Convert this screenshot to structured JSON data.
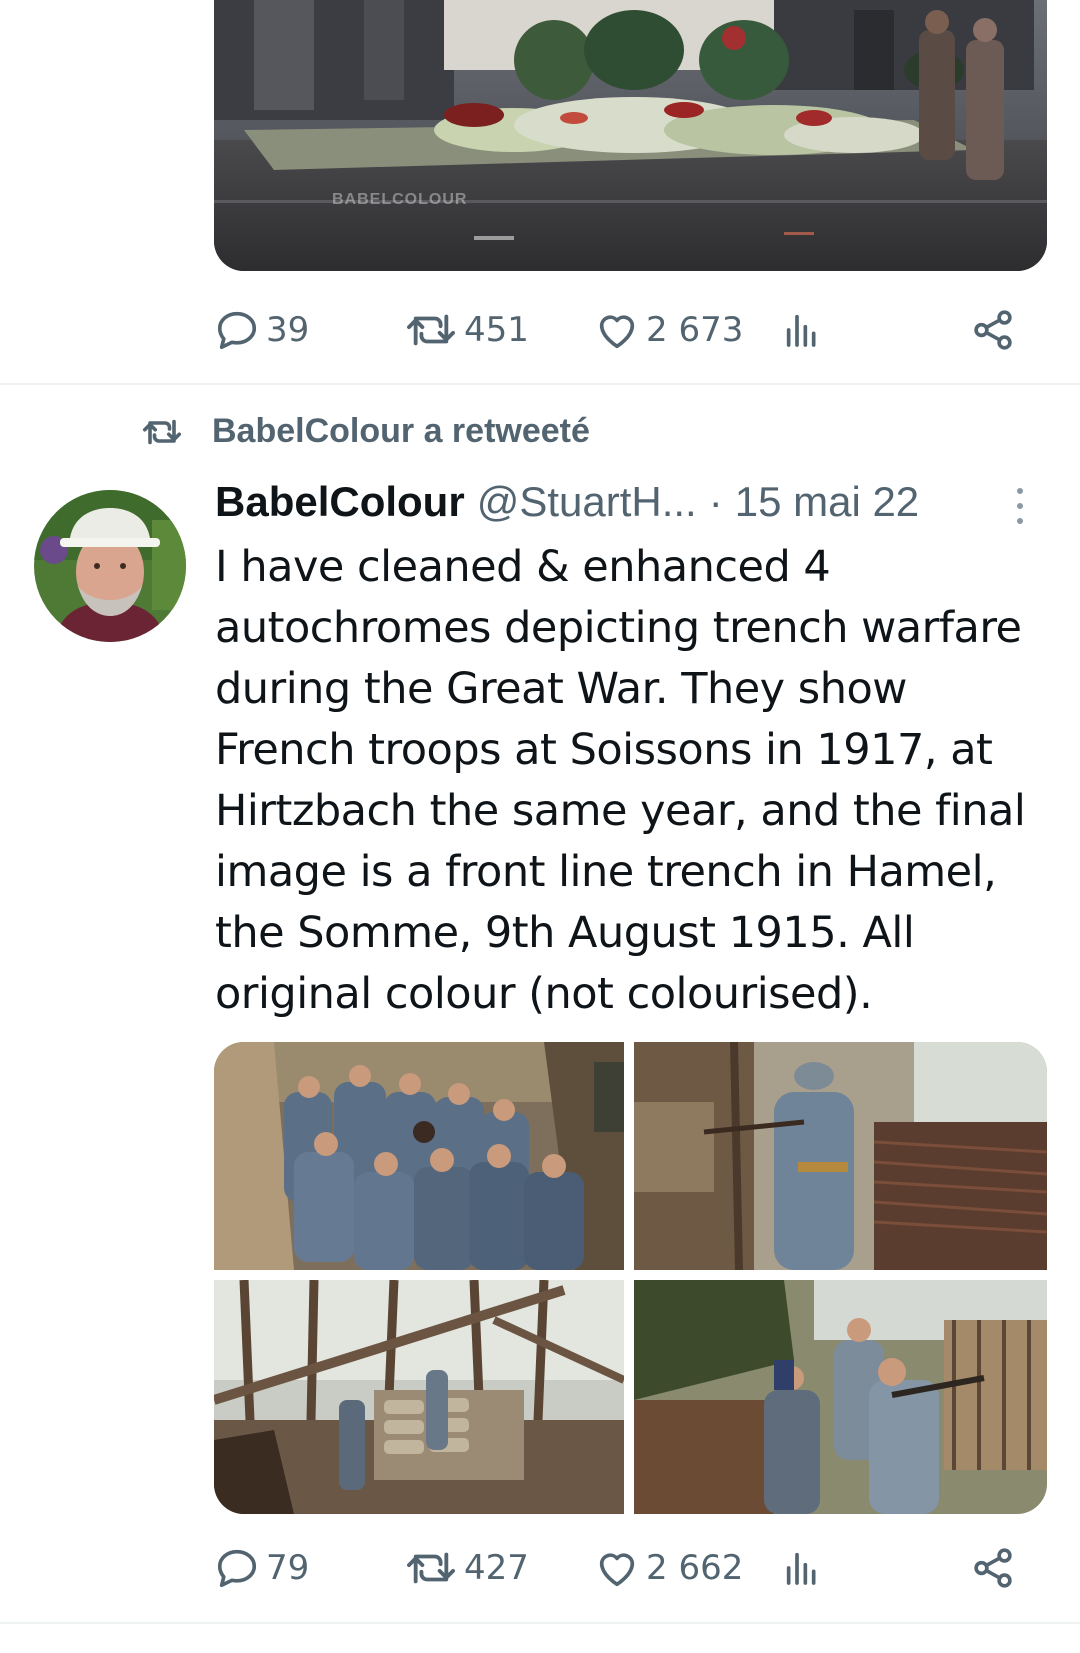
{
  "prev_tweet": {
    "image_watermark": "BABELCOLOUR",
    "stats": {
      "replies": "39",
      "retweets": "451",
      "likes": "2 673"
    }
  },
  "retweet_context": {
    "text": "BabelColour a retweeté"
  },
  "tweet": {
    "author_name": "BabelColour",
    "author_handle": "@StuartH...",
    "separator": "·",
    "date": "15 mai 22",
    "text": "I have cleaned & enhanced 4 autochromes depicting trench warfare during the Great War. They show French troops at Soissons in 1917, at Hirtzbach the same year, and the final image is a front line trench in Hamel, the Somme, 9th August 1915. All original colour (not colourised).",
    "stats": {
      "replies": "79",
      "retweets": "427",
      "likes": "2 662"
    }
  },
  "icons": {
    "reply": "reply-icon",
    "retweet": "retweet-icon",
    "like": "heart-icon",
    "views": "views-icon",
    "share": "share-icon",
    "more": "more-icon"
  },
  "colors": {
    "text_primary": "#0f1419",
    "text_secondary": "#536471",
    "divider": "#eff3f4"
  }
}
